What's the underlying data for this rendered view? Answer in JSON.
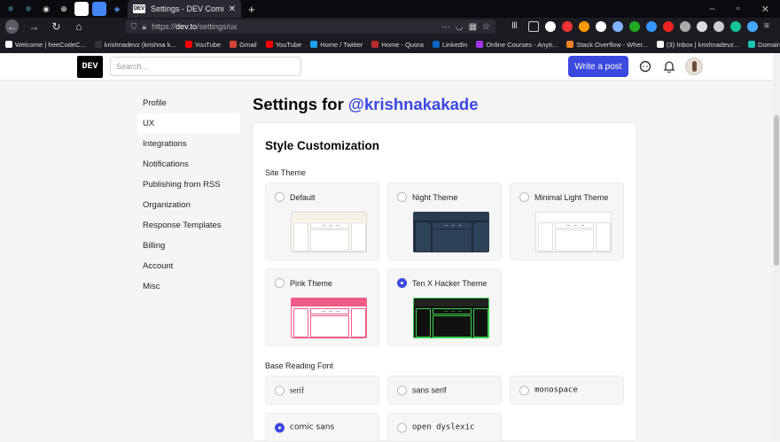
{
  "browser": {
    "tab_title": "Settings - DEV Community",
    "url_prefix": "https://",
    "url_domain": "dev.to",
    "url_path": "/settings/ux",
    "bookmarks": [
      {
        "label": "Welcome | freeCodeC...",
        "color": "#ffffff"
      },
      {
        "label": "krishnadevz (krishna k...",
        "color": "#333333"
      },
      {
        "label": "YouTube",
        "color": "#ff0000"
      },
      {
        "label": "Gmail",
        "color": "#d44638"
      },
      {
        "label": "YouTube",
        "color": "#ff0000"
      },
      {
        "label": "Home / Twitter",
        "color": "#1da1f2"
      },
      {
        "label": "Home - Quora",
        "color": "#b92b27"
      },
      {
        "label": "LinkedIn",
        "color": "#0a66c2"
      },
      {
        "label": "Online Courses - Anyti...",
        "color": "#a435f0"
      },
      {
        "label": "Stack Overflow - Wher...",
        "color": "#f48024"
      },
      {
        "label": "(3) Inbox | krishnadevz...",
        "color": "#ffffff"
      },
      {
        "label": "Domain management ...",
        "color": "#19c4b4"
      }
    ]
  },
  "header": {
    "logo": "DEV",
    "search_placeholder": "Search...",
    "write_button": "Write a post"
  },
  "sidebar": {
    "items": [
      {
        "label": "Profile",
        "active": false
      },
      {
        "label": "UX",
        "active": true
      },
      {
        "label": "Integrations",
        "active": false
      },
      {
        "label": "Notifications",
        "active": false
      },
      {
        "label": "Publishing from RSS",
        "active": false
      },
      {
        "label": "Organization",
        "active": false
      },
      {
        "label": "Response Templates",
        "active": false
      },
      {
        "label": "Billing",
        "active": false
      },
      {
        "label": "Account",
        "active": false
      },
      {
        "label": "Misc",
        "active": false
      }
    ]
  },
  "main": {
    "title_prefix": "Settings for ",
    "username": "@krishnakakade",
    "card_title": "Style Customization",
    "site_theme_label": "Site Theme",
    "themes": [
      {
        "label": "Default",
        "checked": false,
        "bg": "#fdf9f3",
        "bar": "#f6f0e6",
        "col": "#ffffff",
        "stroke": "#dcdcdc",
        "mid": "#ffffff"
      },
      {
        "label": "Night Theme",
        "checked": false,
        "bg": "#1c2938",
        "bar": "#293b50",
        "col": "#2d4257",
        "stroke": "#2d4257",
        "mid": "#2d4257"
      },
      {
        "label": "Minimal Light Theme",
        "checked": false,
        "bg": "#ffffff",
        "bar": "#ffffff",
        "col": "#ffffff",
        "stroke": "#dddddd",
        "mid": "#ffffff"
      },
      {
        "label": "Pink Theme",
        "checked": false,
        "bg": "#ffffff",
        "bar": "#f15b87",
        "col": "#ffffff",
        "stroke": "#f15b87",
        "mid": "#ffffff"
      },
      {
        "label": "Ten X Hacker Theme",
        "checked": true,
        "bg": "#111111",
        "bar": "#222222",
        "col": "#111111",
        "stroke": "#3bd34d",
        "mid": "#111111"
      }
    ],
    "font_label": "Base Reading Font",
    "fonts": [
      {
        "label": "serif",
        "checked": false
      },
      {
        "label": "sans serif",
        "checked": false
      },
      {
        "label": "monospace",
        "checked": false
      },
      {
        "label": "comic sans",
        "checked": true
      },
      {
        "label": "open dyslexic",
        "checked": false
      }
    ]
  }
}
